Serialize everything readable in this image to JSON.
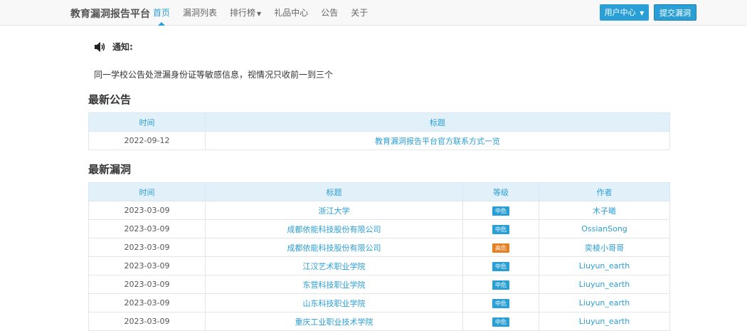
{
  "header": {
    "brand": "教育漏洞报告平台",
    "nav": [
      "首页",
      "漏洞列表",
      "排行榜",
      "礼品中心",
      "公告",
      "关于"
    ],
    "user_center": "用户中心",
    "submit": "提交漏洞"
  },
  "notice": {
    "label": "通知:",
    "text": "同一学校公告处泄漏身份证等敏感信息，视情况只收前一到三个"
  },
  "announcements": {
    "title": "最新公告",
    "columns": [
      "时间",
      "标题"
    ],
    "rows": [
      {
        "time": "2022-09-12",
        "title": "教育漏洞报告平台官方联系方式一览"
      }
    ]
  },
  "vulns": {
    "title": "最新漏洞",
    "columns": [
      "时间",
      "标题",
      "等级",
      "作者"
    ],
    "rows": [
      {
        "time": "2023-03-09",
        "title": "浙江大学",
        "level": "中危",
        "author": "木子曦"
      },
      {
        "time": "2023-03-09",
        "title": "成都依能科技股份有限公司",
        "level": "中危",
        "author": "OssianSong"
      },
      {
        "time": "2023-03-09",
        "title": "成都依能科技股份有限公司",
        "level": "高危",
        "author": "奕棱小哥哥"
      },
      {
        "time": "2023-03-09",
        "title": "江汉艺术职业学院",
        "level": "中危",
        "author": "Liuyun_earth"
      },
      {
        "time": "2023-03-09",
        "title": "东营科技职业学院",
        "level": "中危",
        "author": "Liuyun_earth"
      },
      {
        "time": "2023-03-09",
        "title": "山东科技职业学院",
        "level": "中危",
        "author": "Liuyun_earth"
      },
      {
        "time": "2023-03-09",
        "title": "重庆工业职业技术学院",
        "level": "中危",
        "author": "Liuyun_earth"
      }
    ]
  }
}
